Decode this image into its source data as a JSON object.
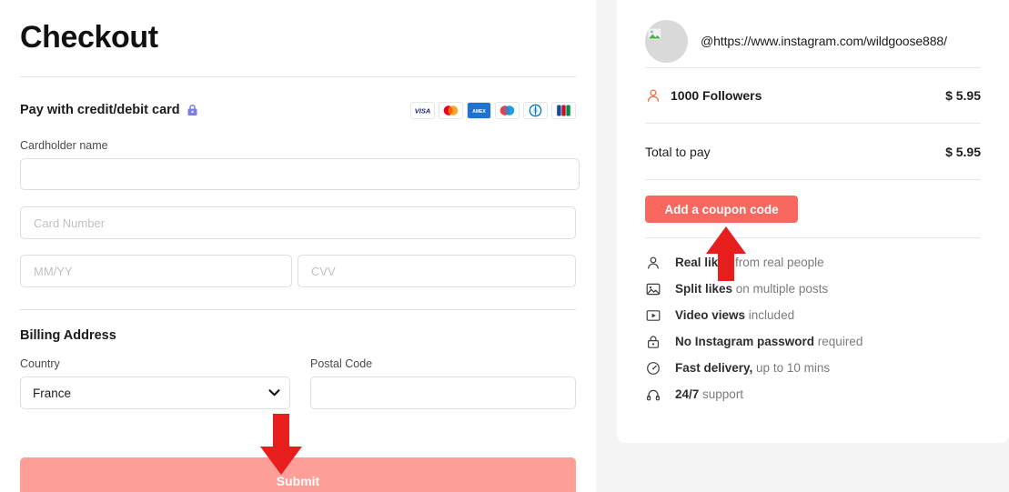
{
  "checkout": {
    "title": "Checkout",
    "pay_label": "Pay with credit/debit card",
    "lock_icon": "lock-icon",
    "card_brands": [
      "VISA",
      "Mastercard",
      "AMEX",
      "Maestro",
      "Diners Club",
      "JCB"
    ],
    "cardholder_label": "Cardholder name",
    "cardholder_value": "",
    "card_number_placeholder": "Card Number",
    "card_number_value": "",
    "expiry_placeholder": "MM/YY",
    "expiry_value": "",
    "cvv_placeholder": "CVV",
    "cvv_value": "",
    "billing_title": "Billing Address",
    "country_label": "Country",
    "country_value": "France",
    "country_options": [
      "France"
    ],
    "postal_label": "Postal Code",
    "postal_value": "",
    "postal_placeholder": "",
    "submit_label": "Submit"
  },
  "summary": {
    "handle": "@https://www.instagram.com/wildgoose888/",
    "avatar_icon": "broken-image-icon",
    "line_item": {
      "icon": "person-icon",
      "label": "1000 Followers",
      "price": "$ 5.95"
    },
    "total": {
      "label": "Total to pay",
      "price": "$ 5.95"
    },
    "coupon_label": "Add a coupon code",
    "features": [
      {
        "icon": "person-icon",
        "bold": "Real likes",
        "rest": " from real people"
      },
      {
        "icon": "image-icon",
        "bold": "Split likes",
        "rest": " on multiple posts"
      },
      {
        "icon": "video-play-icon",
        "bold": "Video views",
        "rest": " included"
      },
      {
        "icon": "lock-icon",
        "bold": "No Instagram password",
        "rest": " required"
      },
      {
        "icon": "speedometer-icon",
        "bold": "Fast delivery,",
        "rest": " up to 10 mins"
      },
      {
        "icon": "headset-icon",
        "bold": "24/7",
        "rest": " support"
      }
    ]
  },
  "annotations": {
    "arrow_down_target": "Submit",
    "arrow_up_target": "Add a coupon code",
    "arrow_color": "#e81d1d"
  },
  "colors": {
    "coupon_button": "#f8685e",
    "submit_button": "#fd9e98",
    "accent_orange": "#ef7048",
    "panel_bg": "#f4f4f4"
  }
}
